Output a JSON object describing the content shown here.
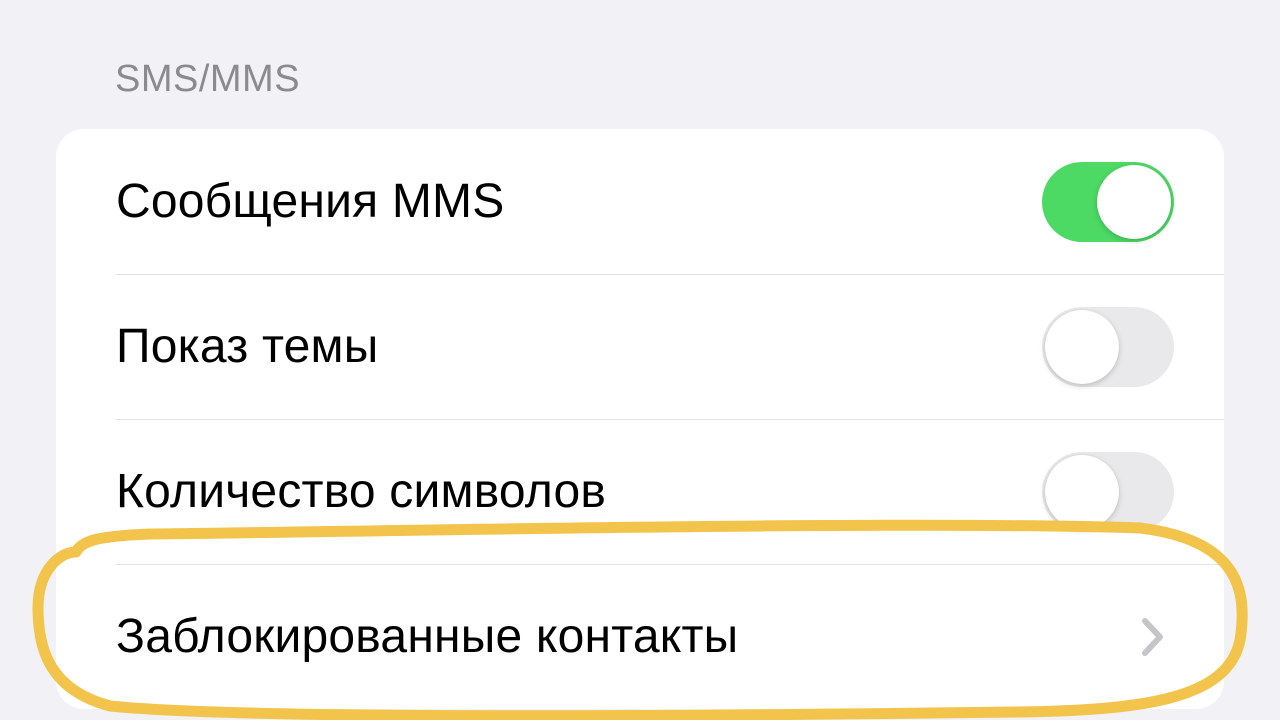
{
  "section": {
    "header": "SMS/MMS"
  },
  "rows": {
    "mms": {
      "label": "Сообщения MMS",
      "toggle": true
    },
    "subject": {
      "label": "Показ темы",
      "toggle": false
    },
    "charcount": {
      "label": "Количество символов",
      "toggle": false
    },
    "blocked": {
      "label": "Заблокированные контакты"
    }
  },
  "annotation": {
    "color": "#f2c44b"
  }
}
